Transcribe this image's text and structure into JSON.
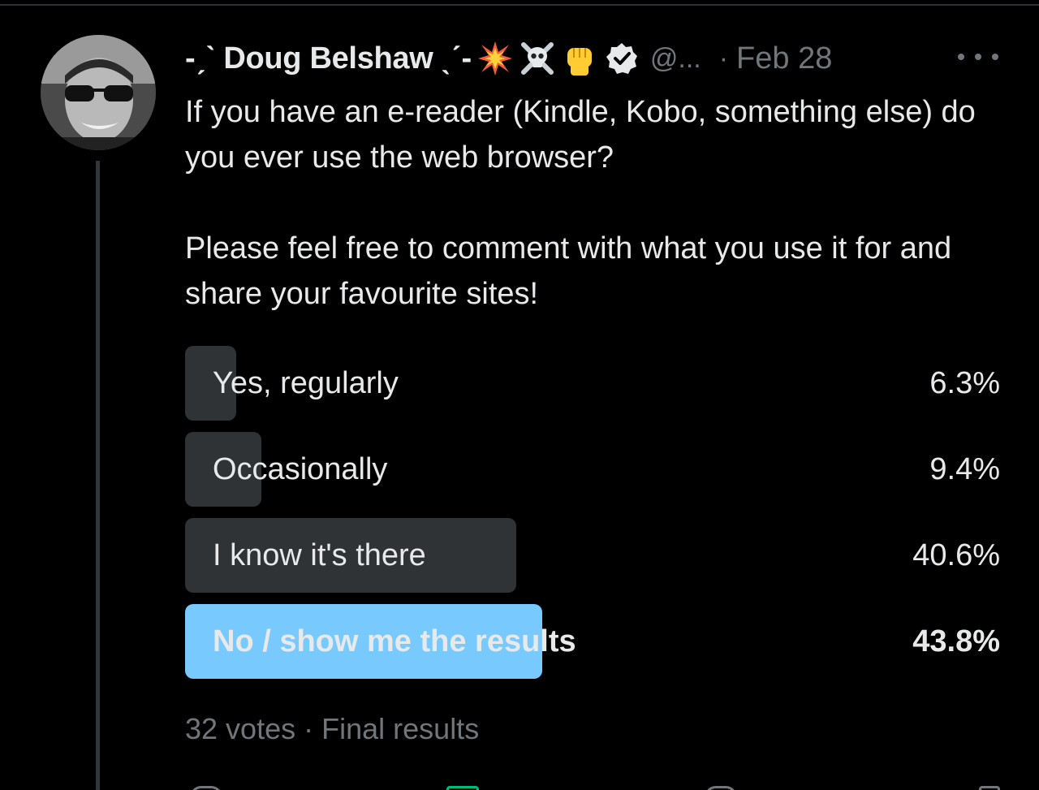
{
  "tweet": {
    "author": {
      "display_name": "-ˏˋ Doug Belshaw ˎˊ-",
      "handle": "@...",
      "emojis": [
        "collision-icon",
        "skull-and-crossbones-icon",
        "raised-fist-icon"
      ],
      "verified": true
    },
    "separator": "·",
    "date": "Feb 28",
    "text_paragraphs": [
      "If you have an e-reader (Kindle, Kobo, something else) do you ever use the web browser?",
      "Please feel free to comment with what you use it for and share your favourite sites!"
    ],
    "poll": {
      "options": [
        {
          "label": "Yes, regularly",
          "percent_text": "6.3%",
          "percent": 6.3,
          "winner": false
        },
        {
          "label": "Occasionally",
          "percent_text": "9.4%",
          "percent": 9.4,
          "winner": false
        },
        {
          "label": "I know it's there",
          "percent_text": "40.6%",
          "percent": 40.6,
          "winner": false
        },
        {
          "label": "No / show me the results",
          "percent_text": "43.8%",
          "percent": 43.8,
          "winner": true
        }
      ],
      "votes": "32 votes",
      "separator": "·",
      "status": "Final results"
    }
  },
  "colors": {
    "background": "#000000",
    "text": "#e7e9ea",
    "muted": "#71767b",
    "bar": "#2f3336",
    "winner_bar": "#78c9fd"
  }
}
